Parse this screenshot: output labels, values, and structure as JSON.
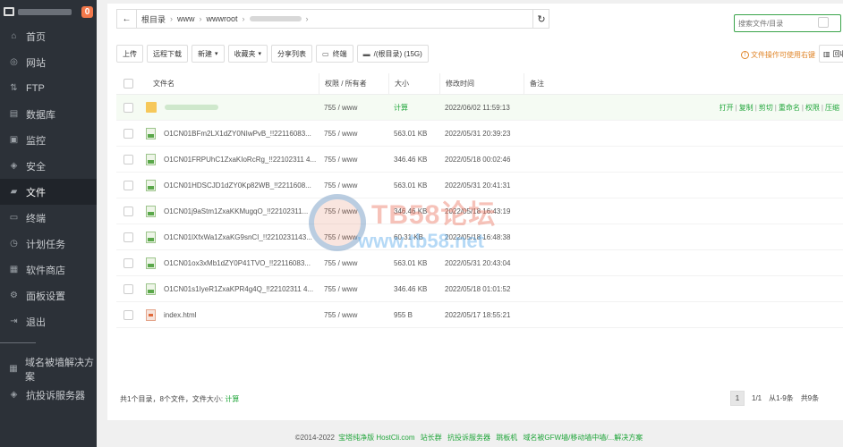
{
  "sidebar": {
    "badge": "0",
    "items": [
      {
        "label": "首页",
        "icon": "home-icon",
        "glyph": "⌂"
      },
      {
        "label": "网站",
        "icon": "globe-icon",
        "glyph": "◎"
      },
      {
        "label": "FTP",
        "icon": "ftp-icon",
        "glyph": "⇅"
      },
      {
        "label": "数据库",
        "icon": "database-icon",
        "glyph": "▤"
      },
      {
        "label": "监控",
        "icon": "monitor-icon",
        "glyph": "▣"
      },
      {
        "label": "安全",
        "icon": "shield-icon",
        "glyph": "◈"
      },
      {
        "label": "文件",
        "icon": "folder-icon",
        "glyph": "▰"
      },
      {
        "label": "终端",
        "icon": "terminal-icon",
        "glyph": "▭"
      },
      {
        "label": "计划任务",
        "icon": "clock-icon",
        "glyph": "◷"
      },
      {
        "label": "软件商店",
        "icon": "apps-icon",
        "glyph": "▦"
      },
      {
        "label": "面板设置",
        "icon": "gear-icon",
        "glyph": "⚙"
      },
      {
        "label": "退出",
        "icon": "logout-icon",
        "glyph": "⇥"
      }
    ],
    "extra": [
      {
        "label": "域名被墙解决方案",
        "icon": "grid-icon",
        "glyph": "▦"
      },
      {
        "label": "抗投诉服务器",
        "icon": "shield-icon",
        "glyph": "◈"
      }
    ]
  },
  "path": {
    "back_glyph": "←",
    "segments": [
      "根目录",
      "www",
      "wwwroot"
    ],
    "sep": "›",
    "refresh_glyph": "↻"
  },
  "search": {
    "placeholder": "搜索文件/目录"
  },
  "toolbar": {
    "upload": "上传",
    "remote_download": "远程下载",
    "new": "新建",
    "favorites": "收藏夹",
    "share_list": "分享列表",
    "terminal": "终端",
    "disk": "/(根目录) (15G)",
    "caret": "▾"
  },
  "tip": {
    "text": "文件操作可使用右键",
    "glyph": "!"
  },
  "recycle": {
    "label": "回收站"
  },
  "table": {
    "headers": {
      "name": "文件名",
      "perm": "权限 / 所有者",
      "size": "大小",
      "mtime": "修改时间",
      "note": "备注"
    },
    "rows": [
      {
        "name": "",
        "perm": "755 / www",
        "size": "计算",
        "mtime": "2022/06/02 11:59:13"
      },
      {
        "name": "O1CN01BFm2LX1dZY0NIwPvB_!!22116083...",
        "perm": "755 / www",
        "size": "563.01 KB",
        "mtime": "2022/05/31 20:39:23"
      },
      {
        "name": "O1CN01FRPUhC1ZxaKIoRcRg_!!22102311 4...",
        "perm": "755 / www",
        "size": "346.46 KB",
        "mtime": "2022/05/18 00:02:46"
      },
      {
        "name": "O1CN01HDSCJD1dZY0Kp82WB_!!2211608...",
        "perm": "755 / www",
        "size": "563.01 KB",
        "mtime": "2022/05/31 20:41:31"
      },
      {
        "name": "O1CN01j9aStm1ZxaKKMugqO_!!22102311...",
        "perm": "755 / www",
        "size": "346.46 KB",
        "mtime": "2022/05/18 16:43:19"
      },
      {
        "name": "O1CN01lXfxWa1ZxaKG9snCI_!!2210231143...",
        "perm": "755 / www",
        "size": "60.31 KB",
        "mtime": "2022/05/18 16:48:38"
      },
      {
        "name": "O1CN01ox3xMb1dZY0P41TVO_!!22116083...",
        "perm": "755 / www",
        "size": "563.01 KB",
        "mtime": "2022/05/31 20:43:04"
      },
      {
        "name": "O1CN01s1IyeR1ZxaKPR4g4Q_!!22102311 4...",
        "perm": "755 / www",
        "size": "346.46 KB",
        "mtime": "2022/05/18 01:01:52"
      },
      {
        "name": "index.html",
        "perm": "755 / www",
        "size": "955 B",
        "mtime": "2022/05/17 18:55:21"
      }
    ],
    "row_ops": [
      "打开",
      "复制",
      "剪切",
      "重命名",
      "权限",
      "压缩"
    ],
    "ops_sep": "|"
  },
  "summary": {
    "text": "共1个目录，8个文件，文件大小:",
    "calc": "计算"
  },
  "pager": {
    "page": "1",
    "pages": "1/1",
    "range": "从1-9条",
    "total": "共9条"
  },
  "copyright": {
    "year": "©2014-2022",
    "links": [
      "宝塔纯净版 HostCli.com",
      "站长群",
      "抗投诉服务器",
      "跳板机",
      "域名被GFW墙/移动墙中墙/...解决方案"
    ]
  },
  "watermark": {
    "title": "TB58论坛",
    "url": "www.tb58.net"
  }
}
